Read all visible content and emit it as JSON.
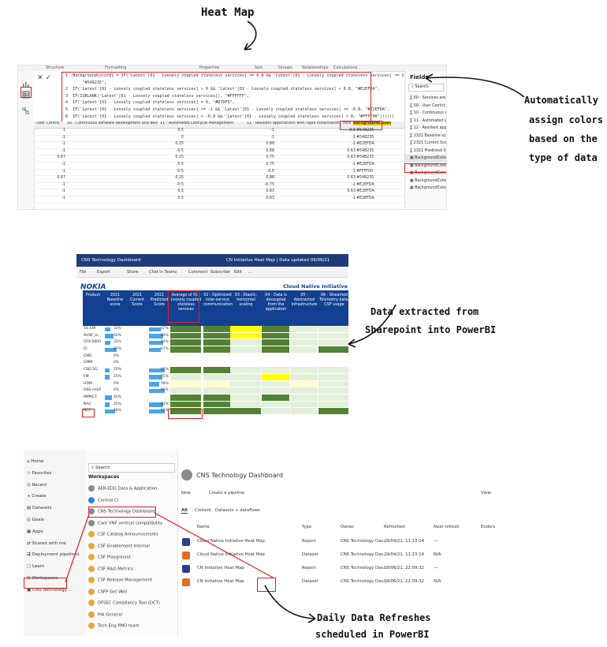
{
  "annotations": {
    "title": "Heat Map",
    "colors_line1": "Automatically",
    "colors_line2": "assign colors",
    "colors_line3": "based on the",
    "colors_line4": "type of data",
    "extract_line1": "Data extracted from",
    "extract_line2": "Sharepoint into PowerBI",
    "refresh_line1": "Daily Data Refreshes",
    "refresh_line2": "scheduled in PowerBI"
  },
  "editor": {
    "ribbon": [
      "Structure",
      "Formatting",
      "Properties",
      "Sort",
      "Groups",
      "Relationships",
      "Calculations"
    ],
    "formula_lines": [
      "1  BackgroundColor01 = IF('Latest'[01 - Loosely coupled stateless services] >= 0.8 && 'Latest'[01 - Loosely coupled stateless services] <= 1,",
      "       \"#548235\",",
      "2  IF('Latest'[01 - Loosely coupled stateless services] > 0 && 'Latest'[01 - Loosely coupled stateless services] < 0.8, \"#E2EFDA\",",
      "3  IF(ISBLANK('Latest'[01 - Loosely coupled stateless services]), \"#FFFFFF\",",
      "4  IF('Latest'[01 - Loosely coupled stateless services] = 0, \"#D7DFD\",",
      "5  IF('Latest'[01 - Loosely coupled stateless services] >= -1 && 'Latest'[01 - Loosely coupled stateless services] <= -0.8, \"#E2EFDA\",",
      "6  IF('Latest'[01 - Loosely coupled stateless services] > -0.8 && 'Latest'[01 - Loosely coupled stateless services] < 0, \"#FFFF00\"))))))"
    ],
    "columns": [
      "- User Centric",
      "10 - Continuous software development and delivery",
      "11 - Automated Lifecycle Management",
      "12 - Resilient applications with rapid instantiation, recov",
      "BackgroundColor01"
    ],
    "rows": [
      [
        "-1",
        "0.5",
        "-1",
        "0.5",
        "#548235"
      ],
      [
        "-1",
        "0",
        "-1",
        "-1",
        "#548235"
      ],
      [
        "-1",
        "0.25",
        "0.88",
        "-1",
        "#E2EFDA"
      ],
      [
        "-1",
        "-0.5",
        "0.88",
        "0.63",
        "#548235"
      ],
      [
        "0.67",
        "0.25",
        "0.75",
        "0.63",
        "#548235"
      ],
      [
        "-1",
        "0.5",
        "0.75",
        "-1",
        "#E2EFDA"
      ],
      [
        "-1",
        "-0.5",
        "-0.5",
        "-1",
        "#FFFF00"
      ],
      [
        "0.67",
        "0.25",
        "0.88",
        "0.63",
        "#548235"
      ],
      [
        "-1",
        "-0.5",
        "-0.75",
        "-1",
        "#E2EFDA"
      ],
      [
        "-1",
        "0.5",
        "0.63",
        "0.63",
        "#E2EFDA"
      ],
      [
        "-1",
        "0.5",
        "0.63",
        "-1",
        "#E2EFDA"
      ]
    ],
    "fields_title": "Fields",
    "fields_search": "Search",
    "fields": [
      "00 - Services are ac...",
      "09 - User Centric",
      "10 - Continuous so...",
      "11 - Automated Lif...",
      "12 - Resilient appli...",
      "2321 Baseline score",
      "2321 Current Score",
      "2321 Predicted Sco...",
      "BackgroundColor01",
      "BackgroundColor02",
      "BackgroundColor03",
      "BackgroundColor04",
      "BackgroundColor05"
    ]
  },
  "dashboard": {
    "app_title": "CNS Technology Dashboard",
    "report_title": "CN Initiative Heat Map  |  Data updated 09/06/21",
    "toolbar": [
      "File",
      "Export",
      "Share",
      "Chat in Teams",
      "Comment",
      "Subscribe",
      "Edit",
      "..."
    ],
    "brand": "NOKIA",
    "chart_title": "Cloud Native Initiative Hea",
    "headers": [
      "Product",
      "2021 Baseline score",
      "2021 Current Score",
      "2021 Predicted Score",
      "Average of 01 - Loosely coupled stateless services",
      "02 - Optimized inter-service communication",
      "03 - Elastic, horizontal scaling",
      "04 - Data is decoupled from the application",
      "05 - Abstracted infrastructure",
      "06 - Streamed Telemetry data, CSF usage"
    ],
    "products": [
      {
        "name": "5G EIR",
        "baseline": 0.33,
        "current": 0.67,
        "predicted": 0.67,
        "baseline_label": "33%",
        "current_label": "",
        "predicted_label": "67%",
        "cells": [
          "#548235",
          "#548235",
          "#FFFF00",
          "#548235",
          "#E2EFDA",
          "#E2EFDA"
        ]
      },
      {
        "name": "AUSF_U...",
        "baseline": 0.5,
        "current": 0.83,
        "predicted": 0.83,
        "baseline_label": "50%",
        "current_label": "",
        "predicted_label": "83%",
        "cells": [
          "#548235",
          "#548235",
          "#FFFF00",
          "#548235",
          "#E2EFDA",
          "#E2EFDA"
        ]
      },
      {
        "name": "CFX-5000",
        "baseline": 0.33,
        "current": 0.83,
        "predicted": 0.83,
        "baseline_label": "33%",
        "current_label": "",
        "predicted_label": "83%",
        "cells": [
          "#548235",
          "#548235",
          "#E2EFDA",
          "#548235",
          "#E2EFDA",
          "#E2EFDA"
        ]
      },
      {
        "name": "CI",
        "baseline": 0.67,
        "current": 0.67,
        "predicted": 0.67,
        "baseline_label": "67%",
        "current_label": "",
        "predicted_label": "67%",
        "cells": [
          "#548235",
          "#548235",
          "#E2EFDA",
          "#548235",
          "#E2EFDA",
          "#548235"
        ]
      },
      {
        "name": "CMG",
        "baseline": 0,
        "current": 0,
        "predicted": 0,
        "baseline_label": "0%",
        "current_label": "",
        "predicted_label": "",
        "cells": [
          "#FFFFFF",
          "#FFFFFF",
          "#FFFFFF",
          "#FFFFFF",
          "#FFFFFF",
          "#FFFFFF"
        ]
      },
      {
        "name": "CMM",
        "baseline": 0,
        "current": 0,
        "predicted": 0,
        "baseline_label": "0%",
        "current_label": "",
        "predicted_label": "",
        "cells": [
          "#FFFFFF",
          "#FFFFFF",
          "#FFFFFF",
          "#FFFFFF",
          "#FFFFFF",
          "#FFFFFF"
        ]
      },
      {
        "name": "CSD 5G",
        "baseline": 0.25,
        "current": 0.92,
        "predicted": 0.92,
        "baseline_label": "25%",
        "current_label": "",
        "predicted_label": "92%",
        "cells": [
          "#548235",
          "#548235",
          "#E2EFDA",
          "#E2EFDA",
          "#E2EFDA",
          "#E2EFDA"
        ]
      },
      {
        "name": "FM",
        "baseline": 0.25,
        "current": 0.75,
        "predicted": 0.75,
        "baseline_label": "25%",
        "current_label": "",
        "predicted_label": "75%",
        "cells": [
          "#E2EFDA",
          "#E2EFDA",
          "#E2EFDA",
          "#FFFF00",
          "#E2EFDA",
          "#E2EFDA"
        ]
      },
      {
        "name": "HDM",
        "baseline": 0,
        "current": 0.58,
        "predicted": 0.58,
        "baseline_label": "0%",
        "current_label": "",
        "predicted_label": "58%",
        "cells": [
          "#FFFFC8",
          "#FFFFC8",
          "#E2EFDA",
          "#E2EFDA",
          "#FFFFC8",
          "#E2EFDA"
        ]
      },
      {
        "name": "HSS+HLR",
        "baseline": 0,
        "current": 0.92,
        "predicted": 0.92,
        "baseline_label": "0%",
        "current_label": "",
        "predicted_label": "92%",
        "cells": [
          "#E2EFDA",
          "#E2EFDA",
          "#E2EFDA",
          "#E2EFDA",
          "#E2EFDA",
          "#E2EFDA"
        ]
      },
      {
        "name": "IMPACT",
        "baseline": 0.42,
        "current": 0,
        "predicted": 0,
        "baseline_label": "42%",
        "current_label": "",
        "predicted_label": "",
        "cells": [
          "#548235",
          "#548235",
          "#E2EFDA",
          "#548235",
          "#E2EFDA",
          "#E2EFDA"
        ]
      },
      {
        "name": "NAC",
        "baseline": 0.25,
        "current": 0.83,
        "predicted": 0.83,
        "baseline_label": "25%",
        "current_label": "",
        "predicted_label": "83%",
        "cells": [
          "#548235",
          "#548235",
          "#E2EFDA",
          "#E2EFDA",
          "#E2EFDA",
          "#E2EFDA"
        ]
      },
      {
        "name": "NCC",
        "baseline": 0.58,
        "current": 0.92,
        "predicted": 0.92,
        "baseline_label": "58%",
        "current_label": "",
        "predicted_label": "92%",
        "cells": [
          "#548235",
          "#548235",
          "#548235",
          "#E2EFDA",
          "#E2EFDA",
          "#548235"
        ]
      }
    ]
  },
  "workspace": {
    "nav": [
      "Home",
      "Favorites",
      "Recent",
      "Create",
      "Datasets",
      "Goals",
      "Apps",
      "Shared with me",
      "Deployment pipelines",
      "Learn",
      "Workspaces",
      "CNS Technology ..."
    ],
    "search": "Search",
    "workspaces_title": "Workspaces",
    "workspaces": [
      "AER-EDG Data & Application",
      "Central CI",
      "CNS Technology Dashboard",
      "Core VNF vertical compatibility",
      "CSF Catalog Announcements",
      "CSF Enablement Internal",
      "CSF Playground",
      "CSF R&D Metrics",
      "CSF Release Management",
      "CSFP Get Well",
      "DFSEC Compliancy Tool (DCT)",
      "PIA General",
      "Tech Eng PMO team"
    ],
    "title": "CNS Technology Dashboard",
    "new_label": "New",
    "pipeline_label": "Create a pipeline",
    "view_label": "View",
    "tabs": [
      "All",
      "Content",
      "Datasets + dataflows"
    ],
    "columns": [
      "Name",
      "Type",
      "Owner",
      "Refreshed",
      "Next refresh",
      "Endorsement"
    ],
    "items": [
      {
        "name": "Cloud Native Initiative Heat Map",
        "type": "Report",
        "owner": "CNS Technology Das...",
        "refreshed": "29/04/21, 11:23:14",
        "next": "—"
      },
      {
        "name": "Cloud Native Initiative Heat Map",
        "type": "Dataset",
        "owner": "CNS Technology Das...",
        "refreshed": "29/04/21, 11:23:14",
        "next": "N/A"
      },
      {
        "name": "CN Initiative Heat Map",
        "type": "Report",
        "owner": "CNS Technology Das...",
        "refreshed": "09/06/21, 22:09:32",
        "next": "—"
      },
      {
        "name": "CN Initiative Heat Map",
        "type": "Dataset",
        "owner": "CNS Technology Das...",
        "refreshed": "09/06/21, 22:09:32",
        "next": "N/A"
      }
    ]
  }
}
